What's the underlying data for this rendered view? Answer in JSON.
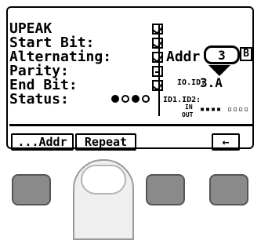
{
  "panel": {
    "rows": [
      {
        "label": "UPEAK",
        "checked": true
      },
      {
        "label": "Start Bit:",
        "checked": true
      },
      {
        "label": "Alternating:",
        "checked": true
      },
      {
        "label": "Parity:",
        "checked": false
      },
      {
        "label": "End Bit:",
        "checked": true
      }
    ],
    "status_label": "Status:",
    "status_dots": [
      true,
      false,
      true,
      false
    ]
  },
  "address": {
    "label": "Addr",
    "value": "3",
    "bank": "B",
    "io_id_label": "IO.ID:",
    "io_id_value": "3.A",
    "id1_id2_label": "ID1.ID2:",
    "in_label": "IN",
    "out_label": "OUT",
    "io_pattern": "▪▪▪▪ ▫▫▫▫"
  },
  "softkeys": {
    "addr_label": "...Addr",
    "repeat_label": "Repeat",
    "back_label": "←"
  },
  "colors": {
    "screen": "#ffffff",
    "button": "#8a8a8a",
    "ink": "#000000"
  }
}
